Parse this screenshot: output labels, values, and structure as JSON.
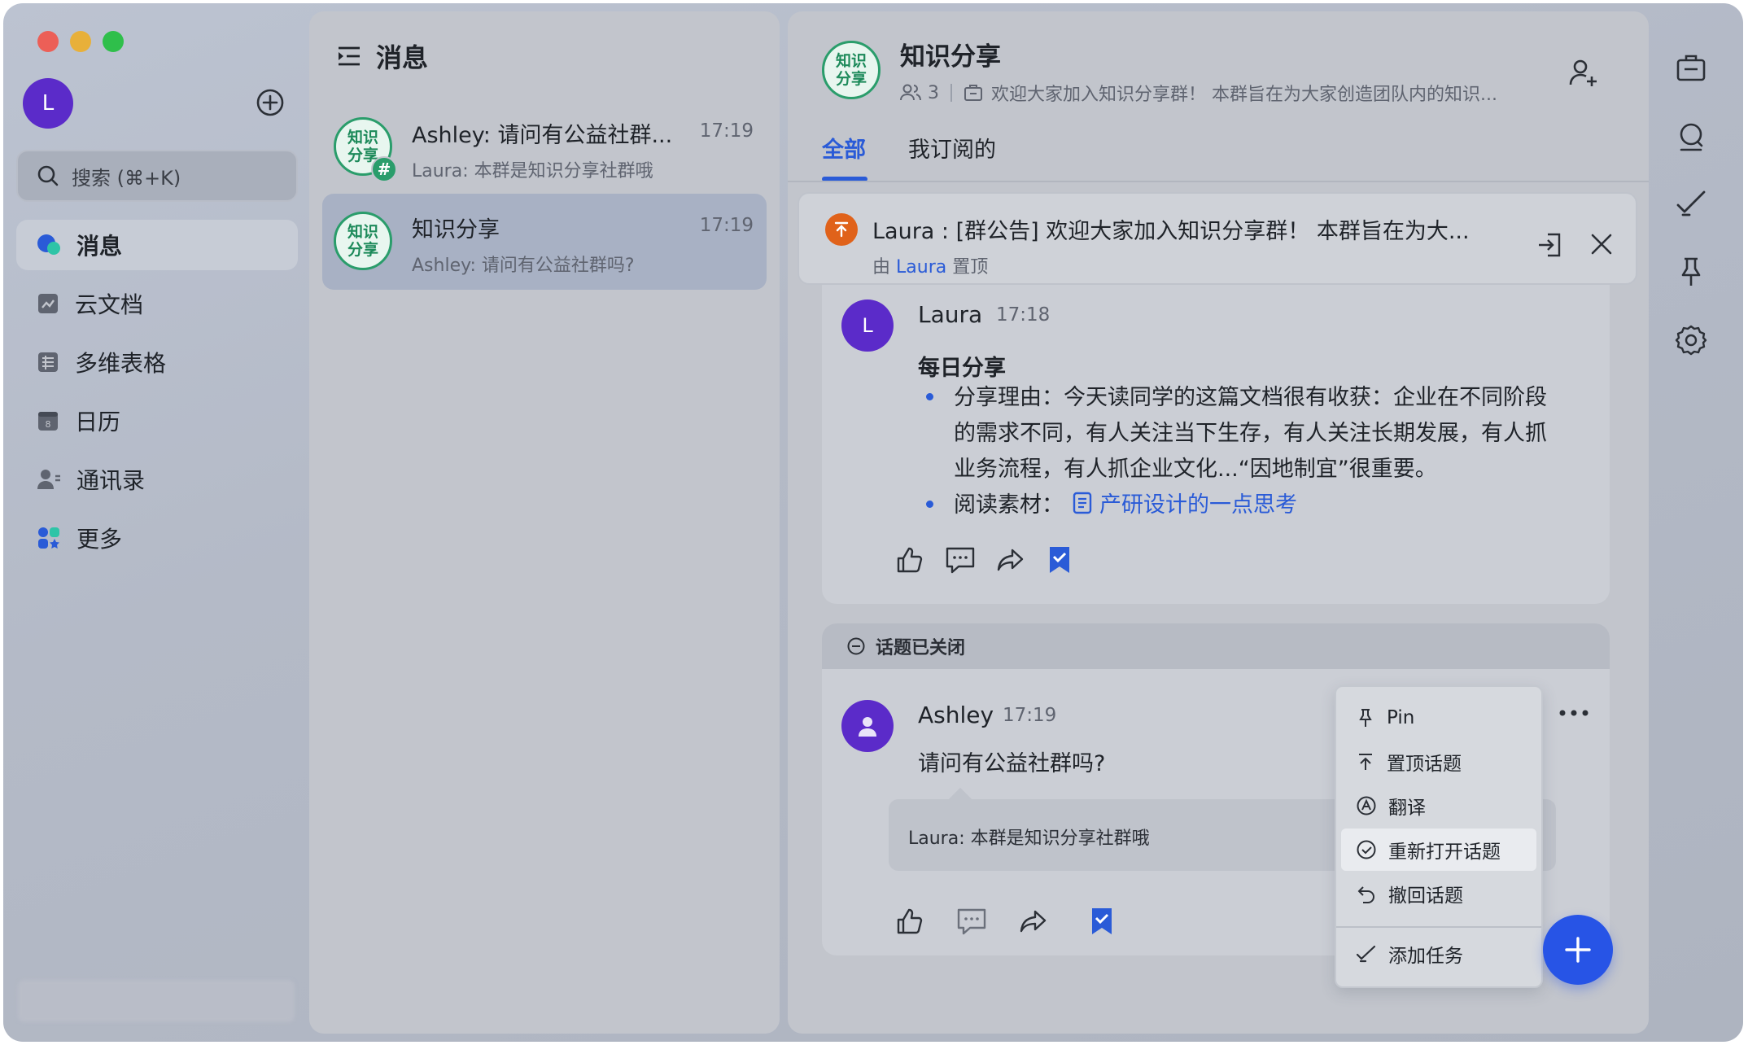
{
  "window": {
    "traffic_lights": {
      "close": "#ec5f57",
      "minimize": "#e8b03a",
      "maximize": "#2fbf4b"
    }
  },
  "sidebar": {
    "avatar_letter": "L",
    "search_placeholder": "搜索 (⌘+K)",
    "items": [
      {
        "label": "消息",
        "icon": "chat-bubbles-icon",
        "active": true
      },
      {
        "label": "云文档",
        "icon": "cloud-doc-icon"
      },
      {
        "label": "多维表格",
        "icon": "table-icon"
      },
      {
        "label": "日历",
        "icon": "calendar-icon"
      },
      {
        "label": "通讯录",
        "icon": "contacts-icon"
      },
      {
        "label": "更多",
        "icon": "apps-icon"
      }
    ]
  },
  "conversations": {
    "title": "消息",
    "items": [
      {
        "avatar": "知识\n分享",
        "name": "Ashley: 请问有公益社群...",
        "time": "17:19",
        "preview": "Laura: 本群是知识分享社群哦",
        "badge": "#"
      },
      {
        "avatar": "知识\n分享",
        "name": "知识分享",
        "time": "17:19",
        "preview": "Ashley: 请问有公益社群吗?",
        "active": true
      }
    ]
  },
  "chat": {
    "group_avatar": "知识\n分享",
    "title": "知识分享",
    "member_count": "3",
    "description": "欢迎大家加入知识分享群！ 本群旨在为大家创造团队内的知识...",
    "tabs": [
      "全部",
      "我订阅的"
    ],
    "pinned": {
      "text": "Laura : [群公告] 欢迎大家加入知识分享群！ 本群旨在为大...",
      "by_prefix": "由",
      "by_user": "Laura",
      "by_suffix": "置顶"
    },
    "msg1": {
      "author": "Laura",
      "avatar_letter": "L",
      "time": "17:18",
      "title": "每日分享",
      "lines": [
        "分享理由：今天读同学的这篇文档很有收获：企业在不同阶段",
        "的需求不同，有人关注当下生存，有人关注长期发展，有人抓",
        "业务流程，有人抓企业文化...“因地制宜”很重要。"
      ],
      "read_label": "阅读素材：",
      "doc_title": "产研设计的一点思考"
    },
    "msg2": {
      "closed_label": "话题已关闭",
      "author": "Ashley",
      "time": "17:19",
      "text": "请问有公益社群吗?",
      "reply": "Laura: 本群是知识分享社群哦"
    },
    "context_menu": [
      {
        "label": "Pin",
        "icon": "pin-icon"
      },
      {
        "label": "置顶话题",
        "icon": "pin-to-top-icon"
      },
      {
        "label": "翻译",
        "icon": "translate-icon"
      },
      {
        "label": "重新打开话题",
        "icon": "check-circle-icon",
        "highlighted": true
      },
      {
        "label": "撤回话题",
        "icon": "undo-icon"
      },
      {
        "label": "添加任务",
        "icon": "task-check-icon"
      }
    ]
  },
  "colors": {
    "accent_blue": "#2a5bd7",
    "fab_blue": "#2754e6",
    "group_green": "#2a9d6b",
    "avatar_purple": "#5b2bc9",
    "announce_orange": "#e0621a"
  }
}
